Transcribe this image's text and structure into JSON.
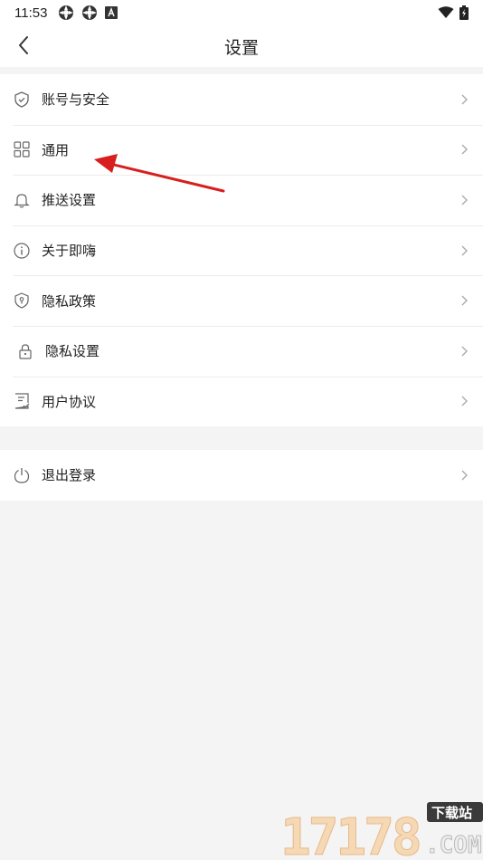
{
  "status_bar": {
    "time": "11:53"
  },
  "header": {
    "title": "设置"
  },
  "settings": [
    {
      "label": "账号与安全",
      "icon": "shield-icon"
    },
    {
      "label": "通用",
      "icon": "grid-icon"
    },
    {
      "label": "推送设置",
      "icon": "bell-icon"
    },
    {
      "label": "关于即嗨",
      "icon": "info-icon"
    },
    {
      "label": "隐私政策",
      "icon": "privacy-shield-icon"
    },
    {
      "label": "隐私设置",
      "icon": "lock-icon"
    },
    {
      "label": "用户协议",
      "icon": "document-icon"
    }
  ],
  "logout": {
    "label": "退出登录",
    "icon": "power-icon"
  },
  "watermark": {
    "number": "17178",
    "site": "下载站",
    "domain": ".COM"
  },
  "colors": {
    "annotation_arrow": "#d81e1e",
    "background": "#f4f4f4",
    "surface": "#ffffff"
  }
}
